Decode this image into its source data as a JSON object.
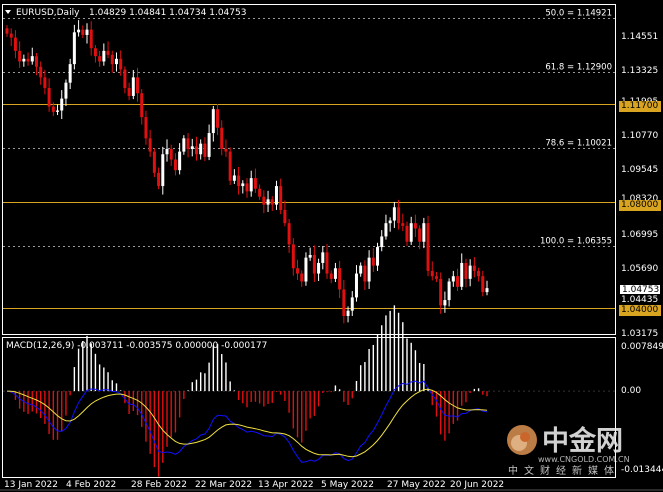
{
  "header": {
    "symbol": "EURUSD,Daily",
    "ohlc": "1.04829 1.04841 1.04734 1.04753"
  },
  "macd": {
    "label": "MACD(12,26,9) -0.003711 -0.003575 0.000000 -0.000177",
    "axis": [
      "0.007849",
      "0.00",
      "-0.013444"
    ],
    "zero": 0
  },
  "price_axis": [
    "1.14551",
    "1.13325",
    "1.11995",
    "1.10770",
    "1.09545",
    "1.08320",
    "1.06995",
    "1.05690",
    "1.04435",
    "1.03175"
  ],
  "date_axis": [
    "13 Jan 2022",
    "4 Feb 2022",
    "28 Feb 2022",
    "22 Mar 2022",
    "13 Apr 2022",
    "5 May 2022",
    "27 May 2022",
    "20 Jun 2022"
  ],
  "fibonacci": [
    {
      "label": "50.0 = 1.14921",
      "price": 1.14921
    },
    {
      "label": "61.8 = 1.12900",
      "price": 1.129
    },
    {
      "label": "78.6 = 1.10021",
      "price": 1.10021
    },
    {
      "label": "100.0 = 1.06355",
      "price": 1.06355
    }
  ],
  "levels": [
    {
      "label": "1.11700",
      "price": 1.117
    },
    {
      "label": "1.08000",
      "price": 1.08
    },
    {
      "label": "1.04000",
      "price": 1.04
    }
  ],
  "current_price": {
    "label": "1.04753",
    "price": 1.04753
  },
  "colors": {
    "background": "#000000",
    "bull": "#ffffff",
    "bear": "#e01010",
    "level": "#d9a520",
    "grid": "#ffffff",
    "macd_main": "#1010ff",
    "macd_signal": "#f0e040"
  },
  "watermark": {
    "brand": "中金网",
    "slogan": "中文财经新媒体",
    "url": "www.CNGOLD.COM.CN",
    "logo_icon": "cngold-logo-icon"
  },
  "chart_data": {
    "type": "candlestick",
    "title": "EURUSD,Daily",
    "x_ticks": [
      "13 Jan 2022",
      "4 Feb 2022",
      "28 Feb 2022",
      "22 Mar 2022",
      "13 Apr 2022",
      "5 May 2022",
      "27 May 2022",
      "20 Jun 2022"
    ],
    "ylim": [
      1.0302,
      1.1543
    ],
    "last_close": 1.04753,
    "close_path": [
      1.1435,
      1.142,
      1.137,
      1.133,
      1.134,
      1.133,
      1.135,
      1.131,
      1.127,
      1.123,
      1.116,
      1.114,
      1.1145,
      1.119,
      1.125,
      1.132,
      1.144,
      1.145,
      1.143,
      1.145,
      1.138,
      1.135,
      1.133,
      1.137,
      1.1355,
      1.132,
      1.134,
      1.13,
      1.123,
      1.12,
      1.127,
      1.121,
      1.112,
      1.104,
      1.099,
      1.091,
      1.086,
      1.098,
      1.1,
      1.096,
      1.092,
      1.099,
      1.104,
      1.1,
      1.101,
      1.098,
      1.102,
      1.097,
      1.106,
      1.115,
      1.108,
      1.1,
      1.099,
      1.088,
      1.09,
      1.086,
      1.087,
      1.084,
      1.089,
      1.085,
      1.082,
      1.079,
      1.081,
      1.079,
      1.086,
      1.077,
      1.072,
      1.064,
      1.055,
      1.053,
      1.05,
      1.059,
      1.06,
      1.053,
      1.057,
      1.061,
      1.053,
      1.051,
      1.055,
      1.047,
      1.037,
      1.039,
      1.044,
      1.053,
      1.056,
      1.05,
      1.059,
      1.056,
      1.063,
      1.067,
      1.072,
      1.073,
      1.078,
      1.072,
      1.071,
      1.065,
      1.072,
      1.07,
      1.065,
      1.072,
      1.054,
      1.052,
      1.051,
      1.041,
      1.043,
      1.05,
      1.052,
      1.048,
      1.057,
      1.051,
      1.056,
      1.054,
      1.052,
      1.046,
      1.0475
    ]
  }
}
